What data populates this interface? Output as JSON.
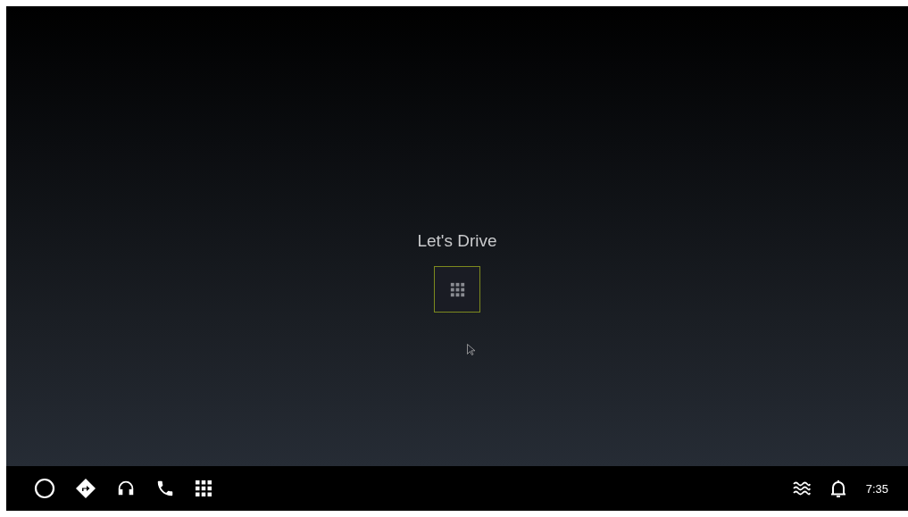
{
  "home": {
    "title": "Let's Drive",
    "launcher_button": {
      "focused": true
    }
  },
  "status_bar": {
    "time": "7:35"
  }
}
